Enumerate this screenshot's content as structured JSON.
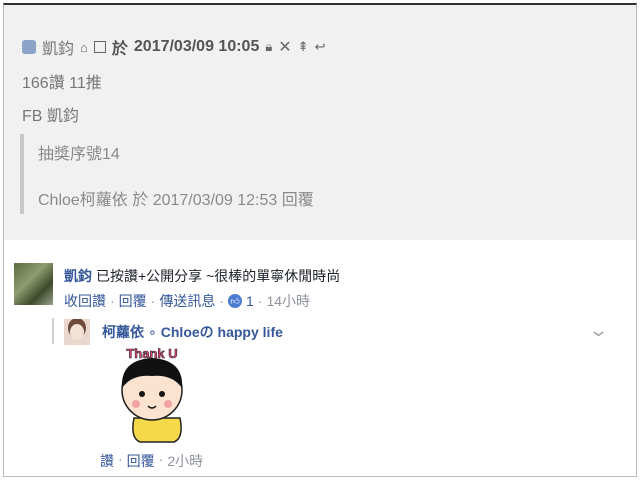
{
  "post": {
    "author": "凱鈞",
    "in_word": "於",
    "datetime": "2017/03/09 10:05",
    "stats": "166讚 11推",
    "source": "FB 凱鈞",
    "quote_text": "抽獎序號14",
    "reply_meta": "Chloe柯蘿依 於 2017/03/09 12:53 回覆"
  },
  "comment": {
    "author": "凱鈞",
    "text": "已按讚+公開分享 ~很棒的單寧休閒時尚",
    "actions": {
      "unlike": "收回讚",
      "reply": "回覆",
      "message": "傳送訊息",
      "like_count": "1",
      "time": "14小時"
    },
    "separator": "·"
  },
  "reply": {
    "author": "柯蘿依",
    "dot": "∘",
    "page": "Chloeの happy life",
    "sticker_text": "Thank U",
    "actions": {
      "like": "讚",
      "reply": "回覆",
      "time": "2小時"
    }
  },
  "icons": [
    "post-icon",
    "home-icon",
    "box-icon",
    "lock-icon",
    "close-icon",
    "pin-icon",
    "reply-arrow-icon",
    "like-icon",
    "chevron-down-icon"
  ]
}
